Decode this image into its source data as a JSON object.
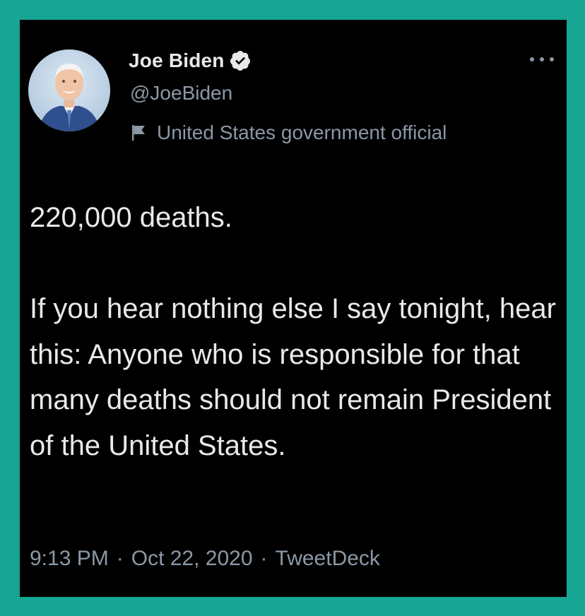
{
  "tweet": {
    "author": {
      "display_name": "Joe Biden",
      "handle": "@JoeBiden",
      "verified": true,
      "label": "United States government official"
    },
    "text": "220,000 deaths.\n\nIf you hear nothing else I say tonight, hear this: Anyone who is responsible for that many deaths should not remain President of the United States.",
    "time": "9:13 PM",
    "separator": "·",
    "date": "Oct 22, 2020",
    "source": "TweetDeck"
  },
  "icons": {
    "verified": "verified-badge-icon",
    "label": "flag-icon",
    "menu": "more-options-icon"
  },
  "colors": {
    "frame": "#17a594",
    "background": "#000000",
    "primary_text": "#e7e9ea",
    "secondary_text": "#8b98a5"
  }
}
